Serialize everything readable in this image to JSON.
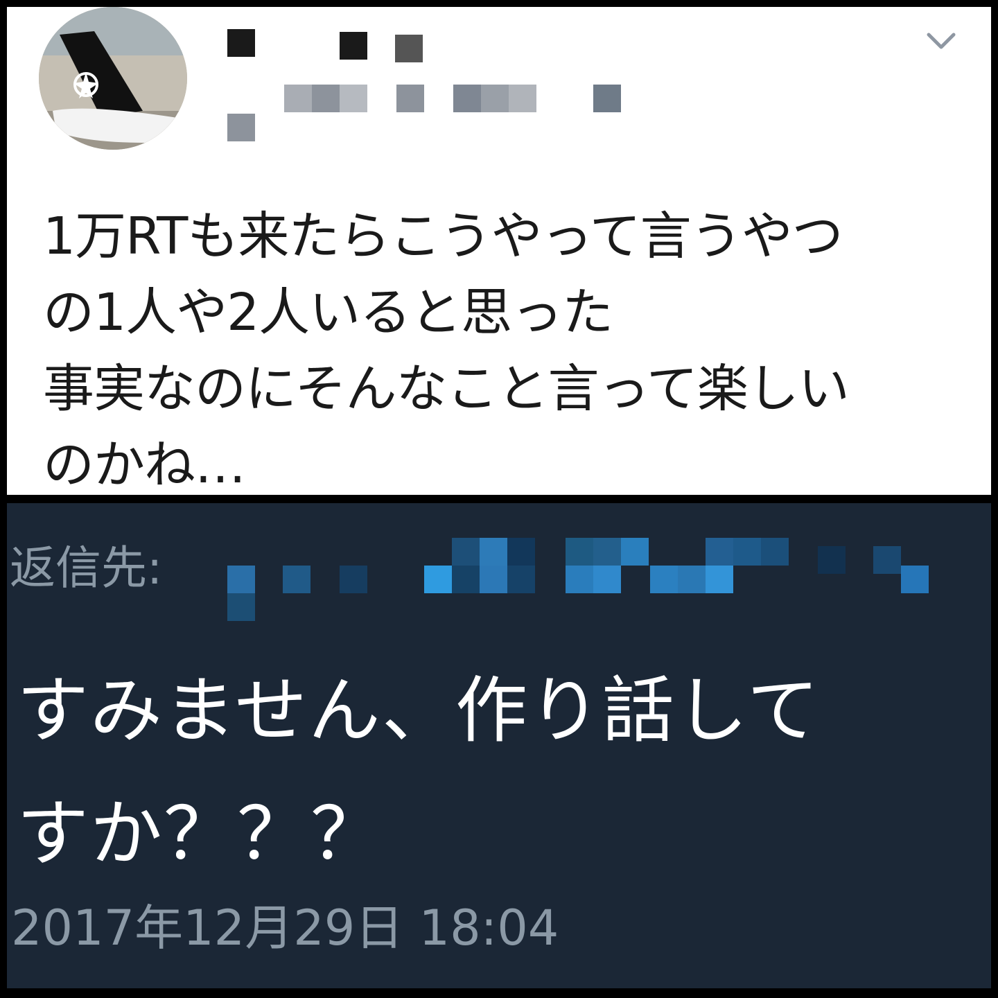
{
  "tweet": {
    "avatar_icon": "airplane-tail-avatar",
    "menu_icon": "chevron-down-icon",
    "text_lines": [
      "1万RTも来たらこうやって言うやつ",
      "の1人や2人いると思った",
      "事実なのにそんなこと言って楽しい",
      "のかね…"
    ]
  },
  "reply": {
    "prefix": "返信先:",
    "text_lines": [
      "すみません、作り話して",
      "すか？？？"
    ],
    "timestamp": "2017年12月29日 18:04"
  },
  "colors": {
    "top_bg": "#ffffff",
    "bottom_bg": "#1b2736",
    "muted_text": "#8b99a6",
    "reply_text": "#ffffff",
    "tweet_text": "#1a1a1a"
  }
}
